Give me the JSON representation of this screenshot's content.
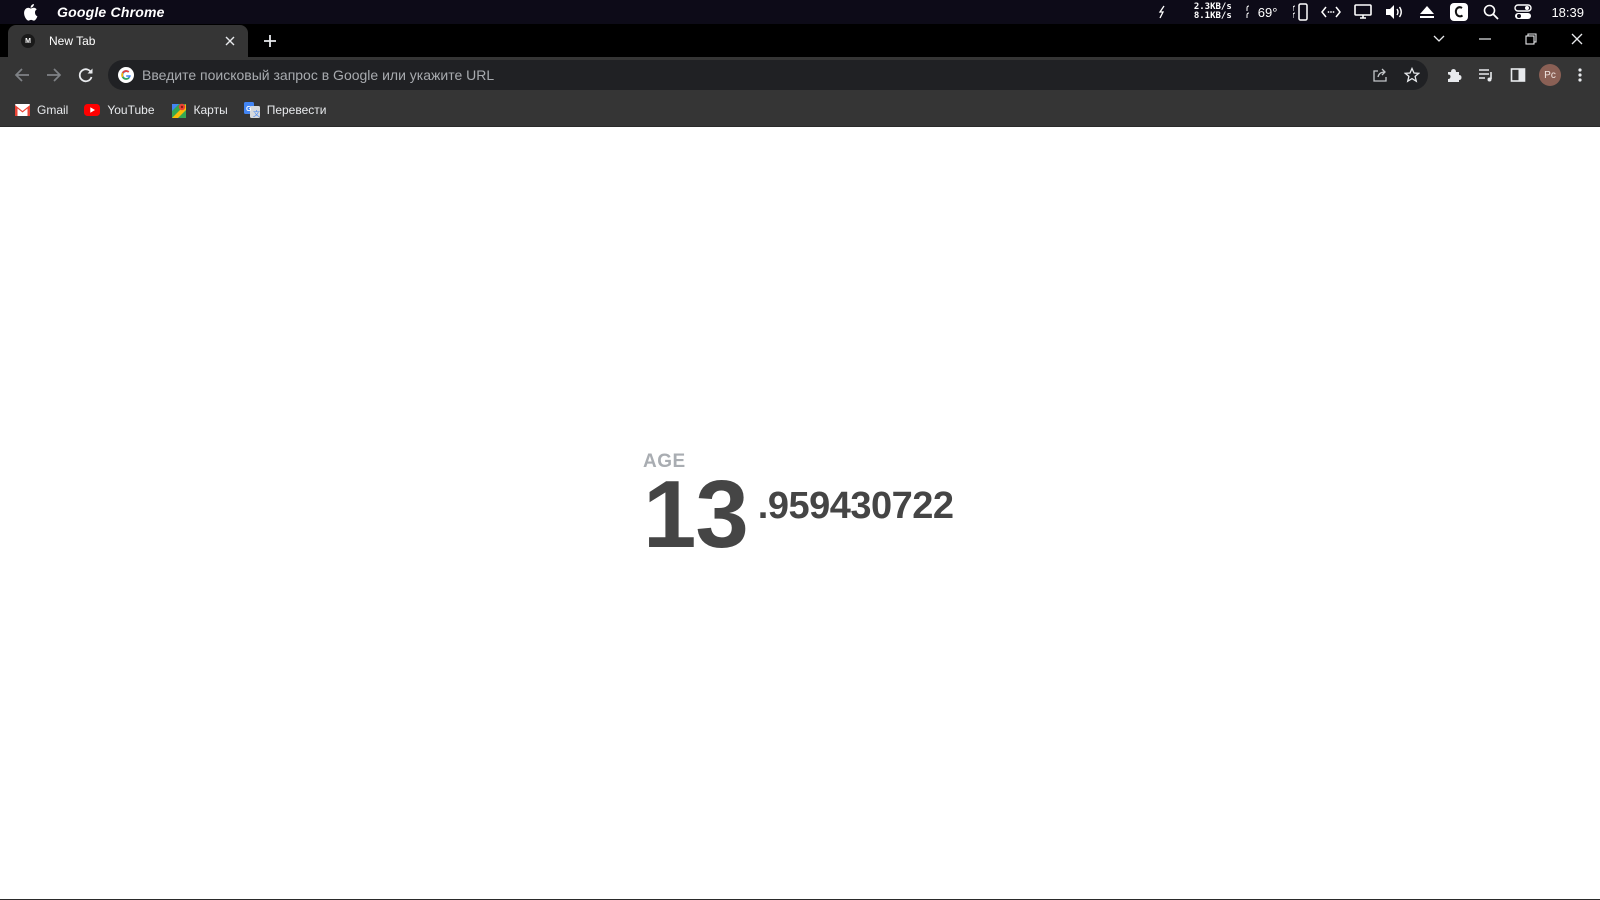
{
  "menubar": {
    "app_name": "Google Chrome",
    "net_up": "2.3KB/s",
    "net_down": "8.1KB/s",
    "temperature": "69°",
    "clock": "18:39",
    "icons": [
      "apple-icon",
      "sync-icon",
      "phone-icon",
      "code-icon",
      "display-icon",
      "volume-icon",
      "eject-icon",
      "c-app-icon",
      "spotlight-search-icon",
      "control-center-icon"
    ]
  },
  "tab": {
    "title": "New Tab",
    "favicon_letter": "M"
  },
  "omnibox": {
    "placeholder": "Введите поисковый запрос в Google или укажите URL",
    "value": ""
  },
  "bookmarks": [
    {
      "label": "Gmail",
      "icon": "gmail-icon"
    },
    {
      "label": "YouTube",
      "icon": "youtube-icon"
    },
    {
      "label": "Карты",
      "icon": "maps-icon"
    },
    {
      "label": "Перевести",
      "icon": "translate-icon"
    }
  ],
  "profile": {
    "initials": "Pc"
  },
  "content": {
    "age_label": "AGE",
    "age_integer": "13",
    "age_fraction": ".959430722"
  },
  "colors": {
    "menubar_bg": "#0d0b18",
    "tabstrip_bg": "#000000",
    "toolbar_bg": "#353535",
    "omnibox_bg": "#202124",
    "age_text": "#454545",
    "age_label": "#a9adb2"
  }
}
